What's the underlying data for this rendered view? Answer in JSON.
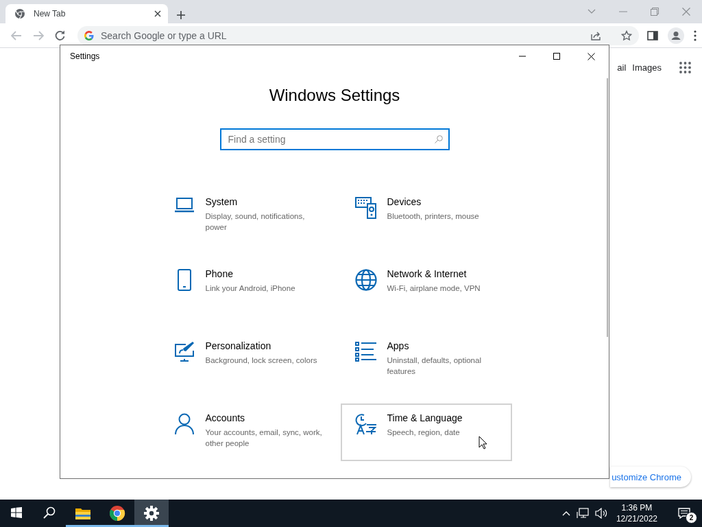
{
  "browser": {
    "tabs": [
      {
        "title": "New Tab",
        "selected": true
      }
    ],
    "omnibox": {
      "placeholder": "Search Google or type a URL"
    },
    "page_links": [
      "ail",
      "Images"
    ],
    "customize_button": "ustomize Chrome"
  },
  "settings_window": {
    "title": "Settings",
    "heading": "Windows Settings",
    "search": {
      "placeholder": "Find a setting"
    },
    "categories": [
      {
        "name": "System",
        "description": "Display, sound, notifications, power",
        "kind": "laptop",
        "hovered": false
      },
      {
        "name": "Devices",
        "description": "Bluetooth, printers, mouse",
        "kind": "devices",
        "hovered": false
      },
      {
        "name": "Phone",
        "description": "Link your Android, iPhone",
        "kind": "phone",
        "hovered": false
      },
      {
        "name": "Network & Internet",
        "description": "Wi-Fi, airplane mode, VPN",
        "kind": "globe",
        "hovered": false
      },
      {
        "name": "Personalization",
        "description": "Background, lock screen, colors",
        "kind": "paint",
        "hovered": false
      },
      {
        "name": "Apps",
        "description": "Uninstall, defaults, optional features",
        "kind": "list",
        "hovered": false
      },
      {
        "name": "Accounts",
        "description": "Your accounts, email, sync, work, other people",
        "kind": "person",
        "hovered": false
      },
      {
        "name": "Time & Language",
        "description": "Speech, region, date",
        "kind": "timelang",
        "hovered": true
      }
    ]
  },
  "taskbar": {
    "apps": [
      {
        "kind": "explorer",
        "running": true,
        "active": false
      },
      {
        "kind": "chrome",
        "running": true,
        "active": false
      },
      {
        "kind": "settings",
        "running": true,
        "active": true
      }
    ],
    "time": "1:36 PM",
    "date": "12/21/2022",
    "notification_count": "2"
  }
}
